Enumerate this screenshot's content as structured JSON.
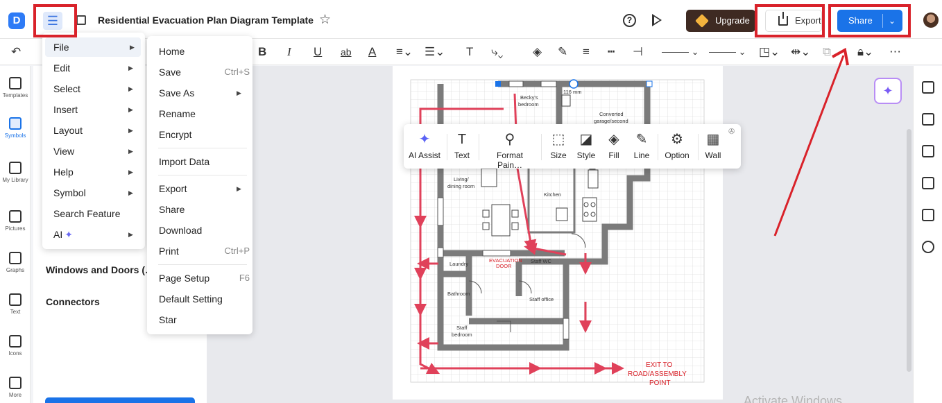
{
  "app": {
    "logo": "D",
    "title": "Residential Evacuation Plan Diagram Template",
    "menu_icon": "hamburger-icon"
  },
  "header": {
    "upgrade": "Upgrade",
    "export": "Export",
    "share": "Share"
  },
  "left_rail": [
    {
      "label": "Templates",
      "icon": "templates-icon"
    },
    {
      "label": "Symbols",
      "icon": "symbols-icon"
    },
    {
      "label": "My Library",
      "icon": "library-icon"
    },
    {
      "label": "Pictures",
      "icon": "pictures-icon"
    },
    {
      "label": "Graphs",
      "icon": "graphs-icon"
    },
    {
      "label": "Text",
      "icon": "text-icon"
    },
    {
      "label": "Icons",
      "icon": "icons-icon"
    },
    {
      "label": "More",
      "icon": "more-icon"
    }
  ],
  "left_panel": {
    "sections": [
      "Windows and Doors (…",
      "Connectors"
    ]
  },
  "main_menu": [
    {
      "label": "File",
      "submenu": true
    },
    {
      "label": "Edit",
      "submenu": true
    },
    {
      "label": "Select",
      "submenu": true
    },
    {
      "label": "Insert",
      "submenu": true
    },
    {
      "label": "Layout",
      "submenu": true
    },
    {
      "label": "View",
      "submenu": true
    },
    {
      "label": "Help",
      "submenu": true
    },
    {
      "label": "Symbol",
      "submenu": true
    },
    {
      "label": "Search Feature",
      "submenu": false
    },
    {
      "label": "AI",
      "submenu": true
    }
  ],
  "file_menu": [
    {
      "label": "Home",
      "shortcut": ""
    },
    {
      "label": "Save",
      "shortcut": "Ctrl+S"
    },
    {
      "label": "Save As",
      "shortcut": "",
      "submenu": true
    },
    {
      "label": "Rename",
      "shortcut": ""
    },
    {
      "label": "Encrypt",
      "shortcut": ""
    },
    {
      "label": "Import Data",
      "shortcut": ""
    },
    {
      "label": "Export",
      "shortcut": "",
      "submenu": true
    },
    {
      "label": "Share",
      "shortcut": ""
    },
    {
      "label": "Download",
      "shortcut": ""
    },
    {
      "label": "Print",
      "shortcut": "Ctrl+P"
    },
    {
      "label": "Page Setup",
      "shortcut": "F6"
    },
    {
      "label": "Default Setting",
      "shortcut": ""
    },
    {
      "label": "Star",
      "shortcut": ""
    }
  ],
  "float_toolbar": [
    {
      "label": "AI Assist",
      "icon": "sparkle-icon"
    },
    {
      "label": "Text",
      "icon": "text-icon"
    },
    {
      "label": "Format Pain…",
      "icon": "format-painter-icon"
    },
    {
      "label": "Size",
      "icon": "size-icon"
    },
    {
      "label": "Style",
      "icon": "style-icon"
    },
    {
      "label": "Fill",
      "icon": "fill-icon"
    },
    {
      "label": "Line",
      "icon": "line-icon"
    },
    {
      "label": "Option",
      "icon": "option-icon"
    },
    {
      "label": "Wall",
      "icon": "wall-icon"
    }
  ],
  "diagram": {
    "rooms": [
      "Becky's",
      "bedroom",
      "Converted",
      "garage/second",
      "Living/",
      "dining room",
      "Kitchen",
      "Laundry",
      "EVACUATION",
      "DOOR",
      "Staff WC",
      "Bathroom",
      "Staff office",
      "Staff",
      "bedroom"
    ],
    "dimension": "116 mm",
    "exit_label": [
      "EXIT TO",
      "ROAD/ASSEMBLY",
      "POINT"
    ]
  },
  "watermark": "Activate Windows",
  "colors": {
    "accent": "#1a73e8",
    "highlight": "#d9222a",
    "arrow": "#e0415a",
    "wall": "#7b7b7b"
  }
}
